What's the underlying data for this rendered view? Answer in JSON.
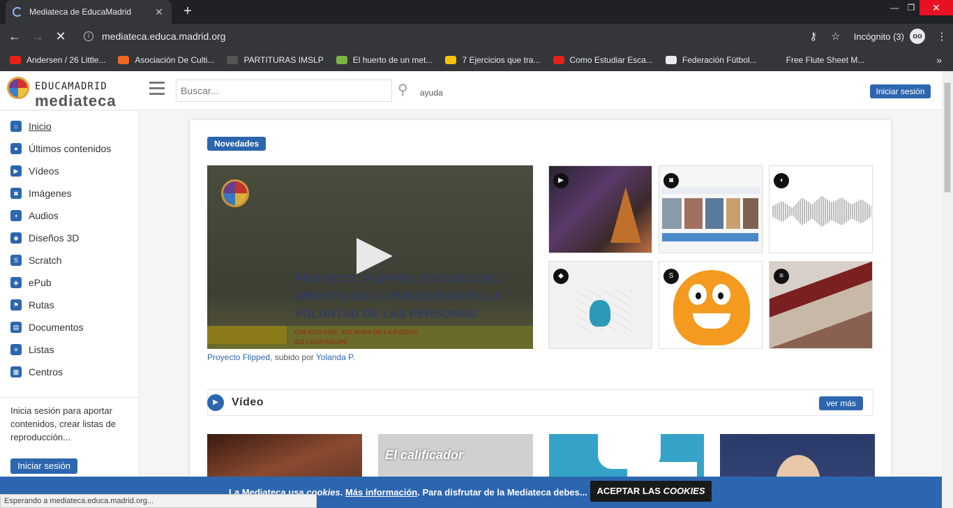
{
  "browser": {
    "tab_title": "Mediateca de EducaMadrid",
    "url": "mediateca.educa.madrid.org",
    "incognito_label": "Incógnito (3)",
    "bookmarks": [
      {
        "label": "Andersen / 26 Little...",
        "color": "#e62117",
        "icon": "youtube-icon"
      },
      {
        "label": "Asociación De Culti...",
        "color": "#f26522",
        "icon": "site-icon"
      },
      {
        "label": "PARTITURAS IMSLP",
        "color": "#555555",
        "icon": "imslp-icon"
      },
      {
        "label": "El huerto de un met...",
        "color": "#7cb342",
        "icon": "blog-icon"
      },
      {
        "label": "7 Ejercicios que tra...",
        "color": "#f4c20d",
        "icon": "ge-icon"
      },
      {
        "label": "Como Estudiar Esca...",
        "color": "#e62117",
        "icon": "youtube-icon"
      },
      {
        "label": "Federación Fútbol...",
        "color": "#e8eaed",
        "icon": "globe-icon"
      },
      {
        "label": "Free Flute Sheet M...",
        "color": "#35363a",
        "icon": "flute-icon"
      }
    ],
    "status_text": "Esperando a mediateca.educa.madrid.org..."
  },
  "header": {
    "logo_top": "EDUCAMADRID",
    "logo_bottom": "mediateca",
    "search_placeholder": "Buscar...",
    "help_label": "ayuda",
    "login_label": "Iniciar sesión"
  },
  "sidebar": {
    "items": [
      {
        "label": "Inicio",
        "icon": "home-icon"
      },
      {
        "label": "Últimos contenidos",
        "icon": "recent-icon"
      },
      {
        "label": "Vídeos",
        "icon": "video-icon"
      },
      {
        "label": "Imágenes",
        "icon": "camera-icon"
      },
      {
        "label": "Audios",
        "icon": "audio-icon"
      },
      {
        "label": "Diseños 3D",
        "icon": "cube-icon"
      },
      {
        "label": "Scratch",
        "icon": "scratch-icon"
      },
      {
        "label": "ePub",
        "icon": "epub-icon"
      },
      {
        "label": "Rutas",
        "icon": "flag-icon"
      },
      {
        "label": "Documentos",
        "icon": "document-icon"
      },
      {
        "label": "Listas",
        "icon": "list-icon"
      },
      {
        "label": "Centros",
        "icon": "building-icon"
      }
    ],
    "message": "Inicia sesión para aportar contenidos, crear listas de reproducción...",
    "login_label": "Iniciar sesión"
  },
  "main": {
    "novedades_label": "Novedades",
    "hero": {
      "title_line1": "PROYECTO FLIPPED: ESTUDIO DEL",
      "title_line2": "IMPACTO DE LA PUBLICIDAD EN LA",
      "title_line3": "VOLUNTAD DE LAS PERSONAS",
      "credit_line1": "CREADO POR: YOLANDA DE LA FUENTE",
      "credit_line2": "IES LEÓN FELIPE",
      "caption_link": "Proyecto Flipped",
      "caption_mid": ", subido por ",
      "caption_user": "Yolanda P."
    },
    "section_title": "Vídeo",
    "see_more": "ver más",
    "video_overlay": "El calificador"
  },
  "cookie": {
    "text_start": "La Mediateca usa ",
    "text_em": "cookies",
    "text_dot": ". ",
    "link": "Más información",
    "text_end": ". Para disfrutar de la Mediateca debes...",
    "button_start": "ACEPTAR LAS ",
    "button_em": "COOKIES"
  }
}
